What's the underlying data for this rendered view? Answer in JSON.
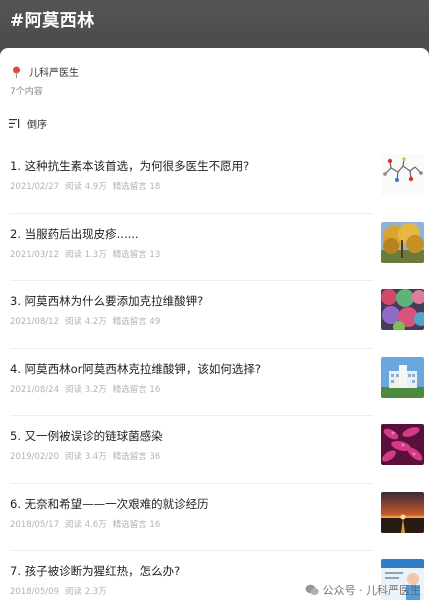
{
  "header": {
    "title": "#阿莫西林"
  },
  "author": {
    "name": "儿科严医生",
    "icon": "location-pin-icon"
  },
  "count_text": "7个内容",
  "sort": {
    "label": "倒序",
    "icon": "sort-icon"
  },
  "articles": [
    {
      "title": "1. 这种抗生素本该首选，为何很多医生不愿用?",
      "date": "2021/02/27",
      "reads": "阅读 4.9万",
      "comments": "精选留言 18",
      "thumb": "molecule"
    },
    {
      "title": "2. 当服药后出现皮疹......",
      "date": "2021/03/12",
      "reads": "阅读 1.3万",
      "comments": "精选留言 13",
      "thumb": "tree"
    },
    {
      "title": "3. 阿莫西林为什么要添加克拉维酸钾?",
      "date": "2021/08/12",
      "reads": "阅读 4.2万",
      "comments": "精选留言 49",
      "thumb": "coral"
    },
    {
      "title": "4. 阿莫西林or阿莫西林克拉维酸钾，该如何选择?",
      "date": "2021/08/24",
      "reads": "阅读 3.2万",
      "comments": "精选留言 16",
      "thumb": "building"
    },
    {
      "title": "5. 又一例被误诊的链球菌感染",
      "date": "2019/02/20",
      "reads": "阅读 3.4万",
      "comments": "精选留言 36",
      "thumb": "bacteria"
    },
    {
      "title": "6. 无奈和希望——一次艰难的就诊经历",
      "date": "2018/05/17",
      "reads": "阅读 4.6万",
      "comments": "精选留言 16",
      "thumb": "sunset"
    },
    {
      "title": "7. 孩子被诊断为猩红热，怎么办?",
      "date": "2018/05/09",
      "reads": "阅读 2.3万",
      "comments": "",
      "thumb": "poster"
    }
  ],
  "watermark": {
    "text": "公众号 · 儿科严医生",
    "icon": "wechat-icon"
  }
}
